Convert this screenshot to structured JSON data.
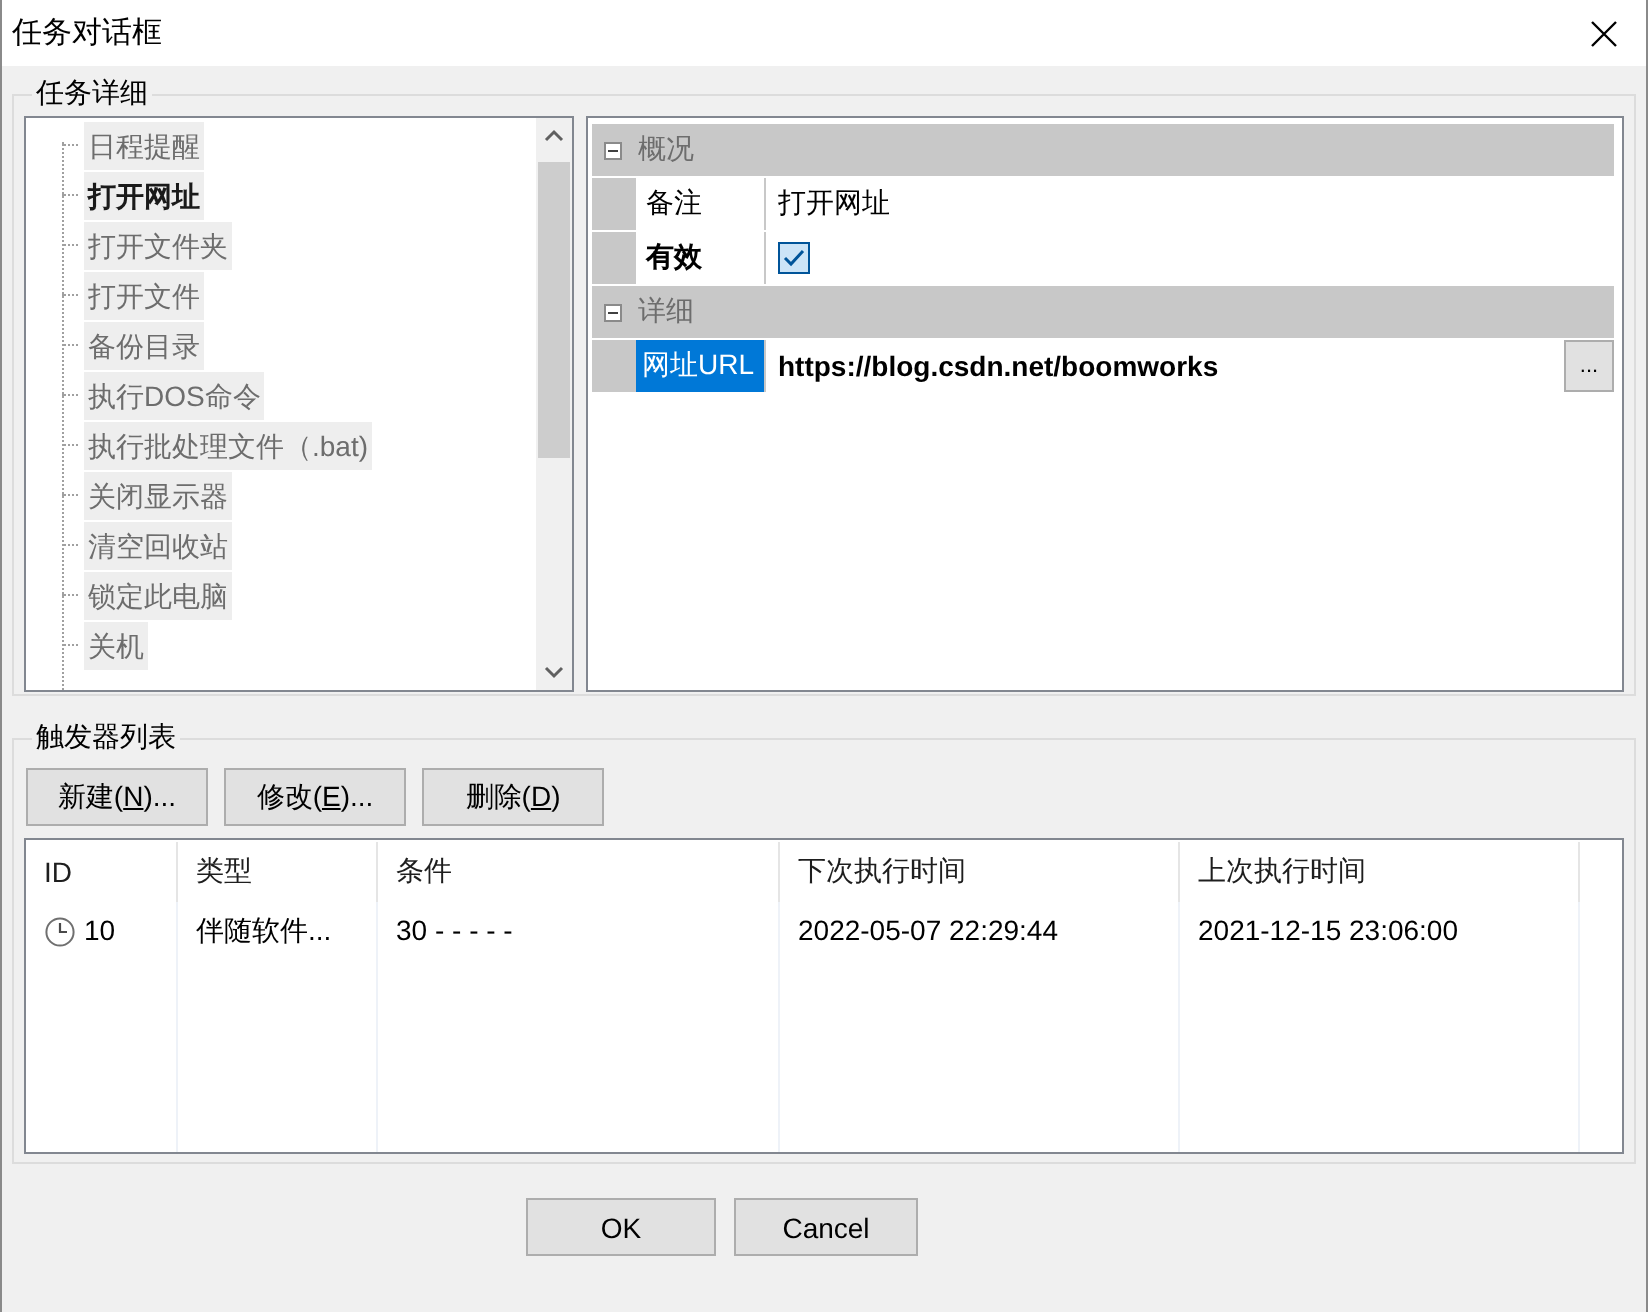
{
  "window": {
    "title": "任务对话框"
  },
  "task_details": {
    "title": "任务详细",
    "task_types": [
      {
        "label": "日程提醒",
        "selected": false
      },
      {
        "label": "打开网址",
        "selected": true
      },
      {
        "label": "打开文件夹",
        "selected": false
      },
      {
        "label": "打开文件",
        "selected": false
      },
      {
        "label": "备份目录",
        "selected": false
      },
      {
        "label": "执行DOS命令",
        "selected": false
      },
      {
        "label": "执行批处理文件（.bat)",
        "selected": false
      },
      {
        "label": "关闭显示器",
        "selected": false
      },
      {
        "label": "清空回收站",
        "selected": false
      },
      {
        "label": "锁定此电脑",
        "selected": false
      },
      {
        "label": "关机",
        "selected": false
      }
    ],
    "properties": [
      {
        "label": "概况",
        "expanded": true,
        "rows": [
          {
            "kind": "text",
            "label": "备注",
            "value": "打开网址",
            "bold_label": false,
            "bold_value": false,
            "selected": false
          },
          {
            "kind": "checkbox",
            "label": "有效",
            "checked": true,
            "bold_label": true,
            "selected": false
          }
        ]
      },
      {
        "label": "详细",
        "expanded": true,
        "rows": [
          {
            "kind": "browse",
            "label": "网址URL",
            "value": "https://blog.csdn.net/boomworks",
            "button": "...",
            "bold_label": false,
            "bold_value": true,
            "selected": true
          }
        ]
      }
    ]
  },
  "triggers": {
    "title": "触发器列表",
    "buttons": [
      {
        "before": "新建(",
        "key": "N",
        "after": ")..."
      },
      {
        "before": "修改(",
        "key": "E",
        "after": ")..."
      },
      {
        "before": "删除(",
        "key": "D",
        "after": ")"
      }
    ],
    "columns": [
      "ID",
      "类型",
      "条件",
      "下次执行时间",
      "上次执行时间"
    ],
    "rows": [
      {
        "cells": [
          "10",
          "伴随软件...",
          "30 - - - - -",
          "2022-05-07 22:29:44",
          "2021-12-15 23:06:00"
        ]
      }
    ]
  },
  "footer_buttons": [
    "OK",
    "Cancel"
  ]
}
